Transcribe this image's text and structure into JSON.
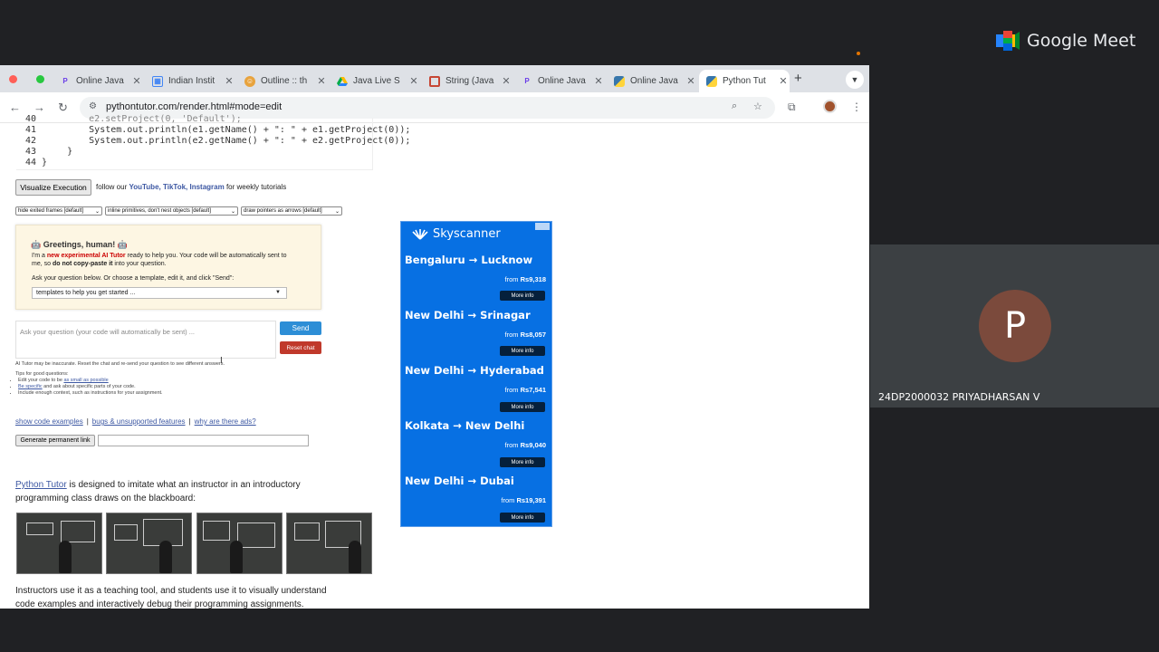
{
  "meet": {
    "app_name": "Google Meet",
    "participant_initial": "P",
    "participant_name": "24DP2000032 PRIYADHARSAN V"
  },
  "browser": {
    "tabs": [
      {
        "label": "Online Java",
        "icon": "replit-icon"
      },
      {
        "label": "Indian Instit",
        "icon": "calendar-icon"
      },
      {
        "label": "Outline :: th",
        "icon": "course-icon"
      },
      {
        "label": "Java Live S",
        "icon": "drive-icon"
      },
      {
        "label": "String (Java",
        "icon": "oracle-icon"
      },
      {
        "label": "Online Java",
        "icon": "replit-icon"
      },
      {
        "label": "Online Java",
        "icon": "python-icon"
      },
      {
        "label": "Python Tut",
        "icon": "python-icon"
      }
    ],
    "active_tab": 7,
    "url": "pythontutor.com/render.html#mode=edit"
  },
  "code": {
    "lines": [
      {
        "n": "40",
        "text": "        e2.setProject(0, 'Default');"
      },
      {
        "n": "41",
        "text": "        System.out.println(e1.getName() + \": \" + e1.getProject(0));"
      },
      {
        "n": "42",
        "text": "        System.out.println(e2.getName() + \": \" + e2.getProject(0));"
      },
      {
        "n": "43",
        "text": "    }"
      },
      {
        "n": "44",
        "text": "}"
      }
    ]
  },
  "controls": {
    "visualize_label": "Visualize Execution",
    "follow_prefix": "follow our",
    "follow_youtube": "YouTube,",
    "follow_tiktok": "TikTok,",
    "follow_instagram": "Instagram",
    "follow_suffix": "for weekly tutorials",
    "select_frames": "hide exited frames [default]",
    "select_primitives": "inline primitives, don't nest objects [default]",
    "select_pointers": "draw pointers as arrows [default]"
  },
  "ai": {
    "greeting": "Greetings, human!",
    "line1_prefix": "I'm a",
    "line1_highlight": "new experimental AI Tutor",
    "line1_suffix": "ready to help you. Your code will be automatically sent to",
    "line2_prefix": "me, so",
    "line2_bold": "do not copy-paste it",
    "line2_suffix": "into your question.",
    "instruction": "Ask your question below. Or choose a template, edit it, and click \"Send\":",
    "template_placeholder": "templates to help you get started ...",
    "ask_placeholder": "Ask your question (your code will automatically be sent) ...",
    "send_label": "Send",
    "reset_label": "Reset chat",
    "disclaimer": "AI Tutor may be inaccurate. Reset the chat and re-send your question to see different answers.",
    "tips_title": "Tips for good questions:",
    "tip1_prefix": "Edit your code to be",
    "tip1_link": "as small as possible",
    "tip2_link": "Be specific",
    "tip2_suffix": "and ask about specific parts of your code.",
    "tip3": "Include enough context, such as instructions for your assignment."
  },
  "links": {
    "examples": "show code examples",
    "bugs": "bugs & unsupported features",
    "ads": "why are there ads?",
    "permalink_label": "Generate permanent link"
  },
  "about": {
    "link": "Python Tutor",
    "line1_suffix": "is designed to imitate what an instructor in an introductory",
    "line2": "programming class draws on the blackboard:",
    "line3": "Instructors use it as a teaching tool, and students use it to visually understand",
    "line4": "code examples and interactively debug their programming assignments."
  },
  "ad": {
    "brand": "Skyscanner",
    "from_label": "from",
    "more_label": "More info",
    "routes": [
      {
        "route": "Bengaluru → Lucknow",
        "price": "Rs9,318"
      },
      {
        "route": "New Delhi → Srinagar",
        "price": "Rs8,057"
      },
      {
        "route": "New Delhi → Hyderabad",
        "price": "Rs7,541"
      },
      {
        "route": "Kolkata → New Delhi",
        "price": "Rs9,040"
      },
      {
        "route": "New Delhi → Dubai",
        "price": "Rs19,391"
      }
    ]
  },
  "colors": {
    "link": "#3d58a3",
    "send": "#2d8ed6",
    "reset": "#c0392b",
    "ad_bg": "#0770e3"
  }
}
